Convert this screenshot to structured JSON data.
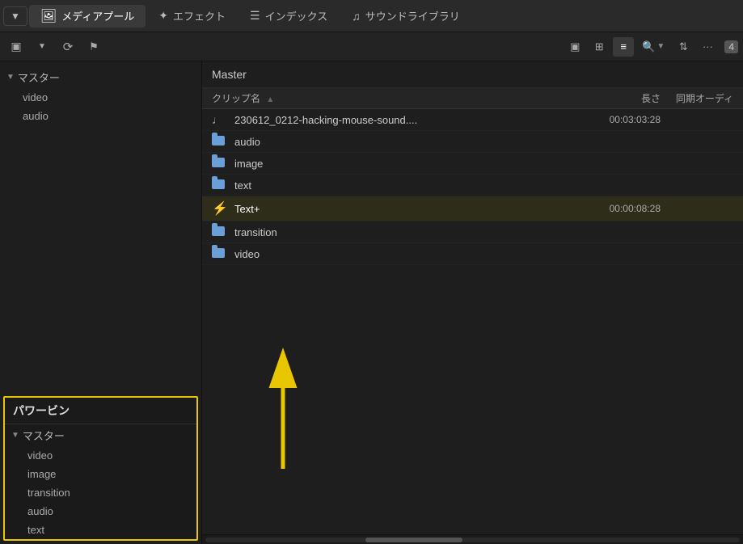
{
  "topnav": {
    "dropdown_label": "▼",
    "mediapull_label": "メディアプール",
    "effect_label": "エフェクト",
    "index_label": "インデックス",
    "soundlib_label": "サウンドライブラリ"
  },
  "toolbar": {
    "view_single": "▣",
    "view_grid": "⊞",
    "view_list": "≡",
    "search_label": "Q",
    "sort_label": "⇅",
    "more_label": "···",
    "badge": "4"
  },
  "sidebar": {
    "master_label": "マスター",
    "items": [
      "video",
      "audio"
    ]
  },
  "powerbin": {
    "title": "パワービン",
    "master_label": "マスター",
    "items": [
      "video",
      "image",
      "transition",
      "audio",
      "text"
    ]
  },
  "content": {
    "header": "Master",
    "col_name": "クリップ名",
    "col_length": "長さ",
    "col_sync": "同期オーディ",
    "rows": [
      {
        "type": "audio",
        "name": "230612_0212-hacking-mouse-sound....",
        "length": "00:03:03:28",
        "sync": ""
      },
      {
        "type": "folder",
        "name": "audio",
        "length": "",
        "sync": ""
      },
      {
        "type": "folder",
        "name": "image",
        "length": "",
        "sync": ""
      },
      {
        "type": "folder",
        "name": "text",
        "length": "",
        "sync": ""
      },
      {
        "type": "lightning",
        "name": "Text+",
        "length": "00:00:08:28",
        "sync": ""
      },
      {
        "type": "folder",
        "name": "transition",
        "length": "",
        "sync": ""
      },
      {
        "type": "folder",
        "name": "video",
        "length": "",
        "sync": ""
      }
    ]
  }
}
